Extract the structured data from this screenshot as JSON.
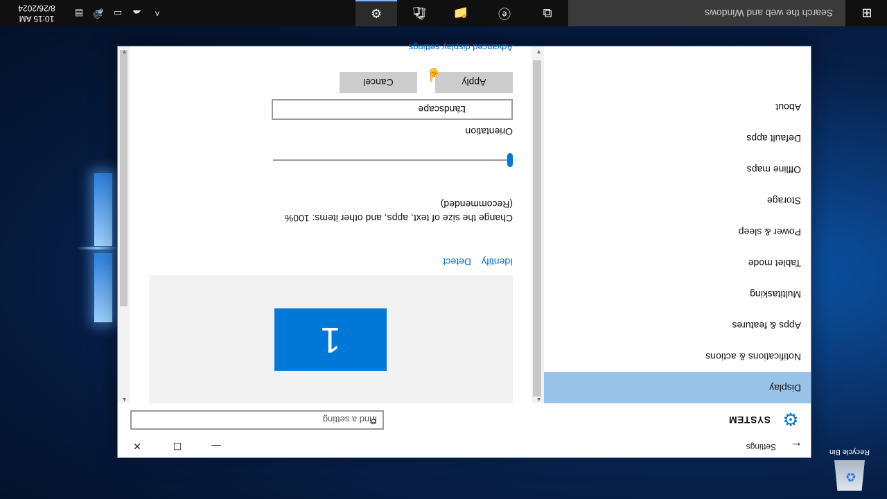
{
  "desktop": {
    "recycle_bin_label": "Recycle Bin"
  },
  "window": {
    "title": "Settings",
    "back_glyph": "←",
    "minimize_glyph": "—",
    "maximize_glyph": "☐",
    "close_glyph": "✕"
  },
  "header": {
    "section": "SYSTEM",
    "search_placeholder": "Find a setting"
  },
  "nav": {
    "items": [
      {
        "label": "Display",
        "active": true
      },
      {
        "label": "Notifications & actions"
      },
      {
        "label": "Apps & features"
      },
      {
        "label": "Multitasking"
      },
      {
        "label": "Tablet mode"
      },
      {
        "label": "Power & sleep"
      },
      {
        "label": "Storage"
      },
      {
        "label": "Offline maps"
      },
      {
        "label": "Default apps"
      },
      {
        "label": "About"
      }
    ]
  },
  "display": {
    "monitor_number": "1",
    "identify": "Identify",
    "detect": "Detect",
    "scale_label": "Change the size of text, apps, and other items: 100%",
    "scale_note": "(Recommended)",
    "scale_value": 0,
    "orientation_label": "Orientation",
    "orientation_value": "Landscape",
    "apply": "Apply",
    "cancel": "Cancel",
    "advanced": "Advanced display settings"
  },
  "taskbar": {
    "search_placeholder": "Search the web and Windows",
    "time": "10:15 AM",
    "date": "8/26/2024"
  },
  "colors": {
    "accent": "#0078d7",
    "selected_nav": "#99c3e8",
    "taskbar": "#101010"
  }
}
